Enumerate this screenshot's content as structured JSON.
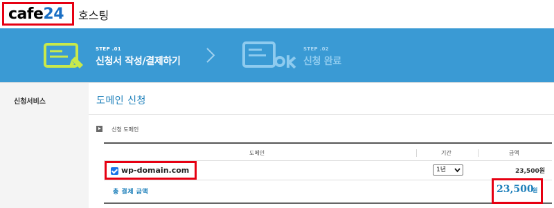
{
  "header": {
    "logo_text": "cafe",
    "logo_num": "24",
    "service_name": "호스팅"
  },
  "steps": [
    {
      "number": "STEP .01",
      "title": "신청서 작성/결제하기",
      "state": "active"
    },
    {
      "number": "STEP .02",
      "title": "신청 완료",
      "state": "inactive"
    }
  ],
  "sidebar": {
    "label": "신청서비스"
  },
  "main": {
    "section_title": "도메인 신청",
    "sub_title": "신청 도메인",
    "table": {
      "headers": {
        "domain": "도메인",
        "period": "기간",
        "amount": "금액"
      },
      "rows": [
        {
          "checked": true,
          "domain": "wp-domain.com",
          "period": "1년",
          "price": "23,500원"
        }
      ],
      "total": {
        "label": "총 결제 금액",
        "amount": "23,500",
        "unit": "원"
      }
    }
  },
  "colors": {
    "banner": "#3a9ad4",
    "accent": "#1c7fba",
    "highlight": "#e60012",
    "step_icon": "#c9e94a"
  }
}
